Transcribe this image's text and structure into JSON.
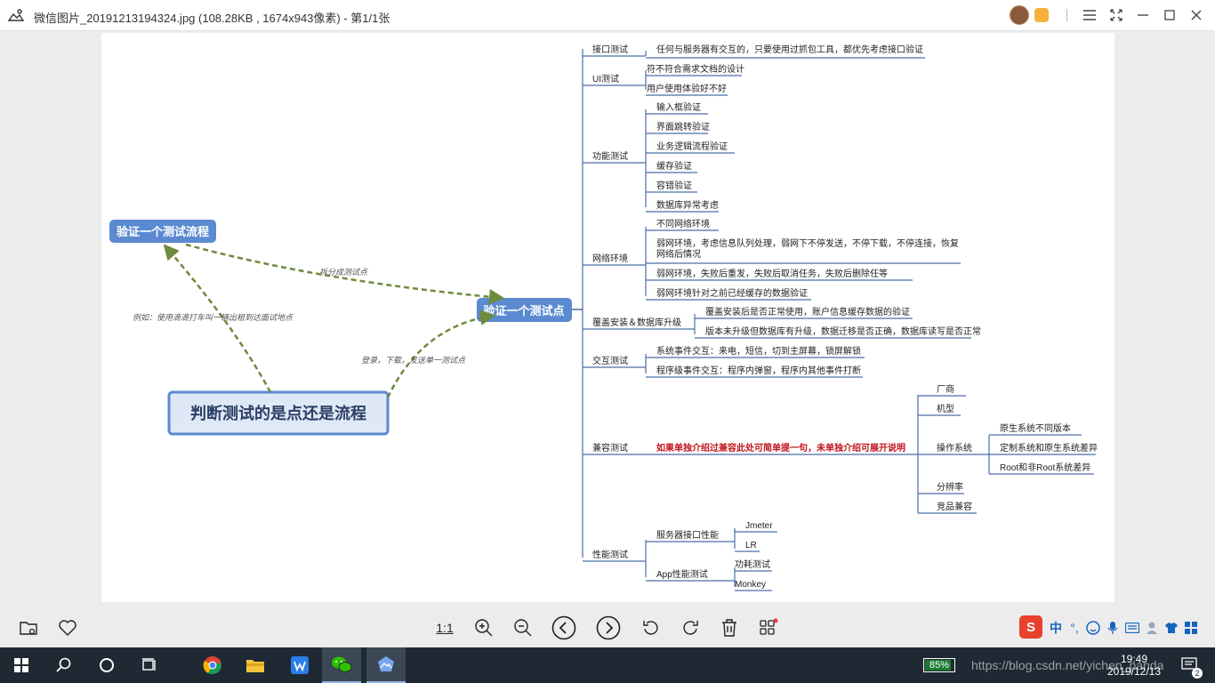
{
  "window": {
    "title": "微信图片_20191213194324.jpg (108.28KB , 1674x943像素) - 第1/1张"
  },
  "mindmap": {
    "root_left": "判断测试的是点还是流程",
    "left_flow": "验证一个测试流程",
    "center": "验证一个测试点",
    "edge_split": "拆分成测试点",
    "edge_example": "例如：使用滴滴打车叫一辆出租到达面试地点",
    "edge_login": "登录，下载，发送单一测试点",
    "branches": [
      {
        "label": "接口测试",
        "items": [
          "任何与服务器有交互的，只要使用过抓包工具，都优先考虑接口验证"
        ]
      },
      {
        "label": "UI测试",
        "items": [
          "符不符合需求文档的设计",
          "用户使用体验好不好"
        ]
      },
      {
        "label": "功能测试",
        "items": [
          "输入框验证",
          "界面跳转验证",
          "业务逻辑流程验证",
          "缓存验证",
          "容错验证",
          "数据库异常考虑"
        ]
      },
      {
        "label": "网络环境",
        "items": [
          "不同网络环境",
          "弱网环境，考虑信息队列处理，弱网下不停发送，不停下载，不停连接，恢复",
          "网络后情况",
          "弱网环境，失败后重发，失败后取消任务，失败后删除任等",
          "弱网环境针对之前已经缓存的数据验证"
        ]
      },
      {
        "label": "覆盖安装＆数据库升级",
        "items": [
          "覆盖安装后是否正常使用，账户信息缓存数据的验证",
          "版本未升级但数据库有升级，数据迁移是否正确，数据库读写是否正常"
        ]
      },
      {
        "label": "交互测试",
        "items": [
          "系统事件交互：来电，短信，切到主屏幕，锁屏解锁",
          "程序级事件交互：程序内弹窗，程序内其他事件打断"
        ]
      },
      {
        "label": "兼容测试",
        "note": "如果单独介绍过兼容此处可简单提一句，未单独介绍可展开说明",
        "items": [
          "厂商",
          "机型",
          "操作系统",
          "分辨率",
          "竞品兼容"
        ],
        "os_items": [
          "原生系统不同版本",
          "定制系统和原生系统差异",
          "Root和非Root系统差异"
        ]
      },
      {
        "label": "性能测试",
        "items": [
          "服务器接口性能",
          "App性能测试"
        ],
        "server_items": [
          "Jmeter",
          "LR"
        ],
        "app_items": [
          "功耗测试",
          "Monkey"
        ]
      }
    ]
  },
  "toolbar": {
    "one_to_one": "1:1"
  },
  "taskbar": {
    "battery": "85%",
    "time": "19:49",
    "date": "2019/12/13",
    "ime_label": "中",
    "watermark": "https://blog.csdn.net/yichen_panda",
    "notif_count": "2"
  },
  "colors": {
    "node_blue": "#5b8ad1",
    "node_border": "#3f6fb8",
    "edge_green": "#6e8a3c",
    "branch_line": "#4a6ea9",
    "note_red": "#c0141a"
  }
}
